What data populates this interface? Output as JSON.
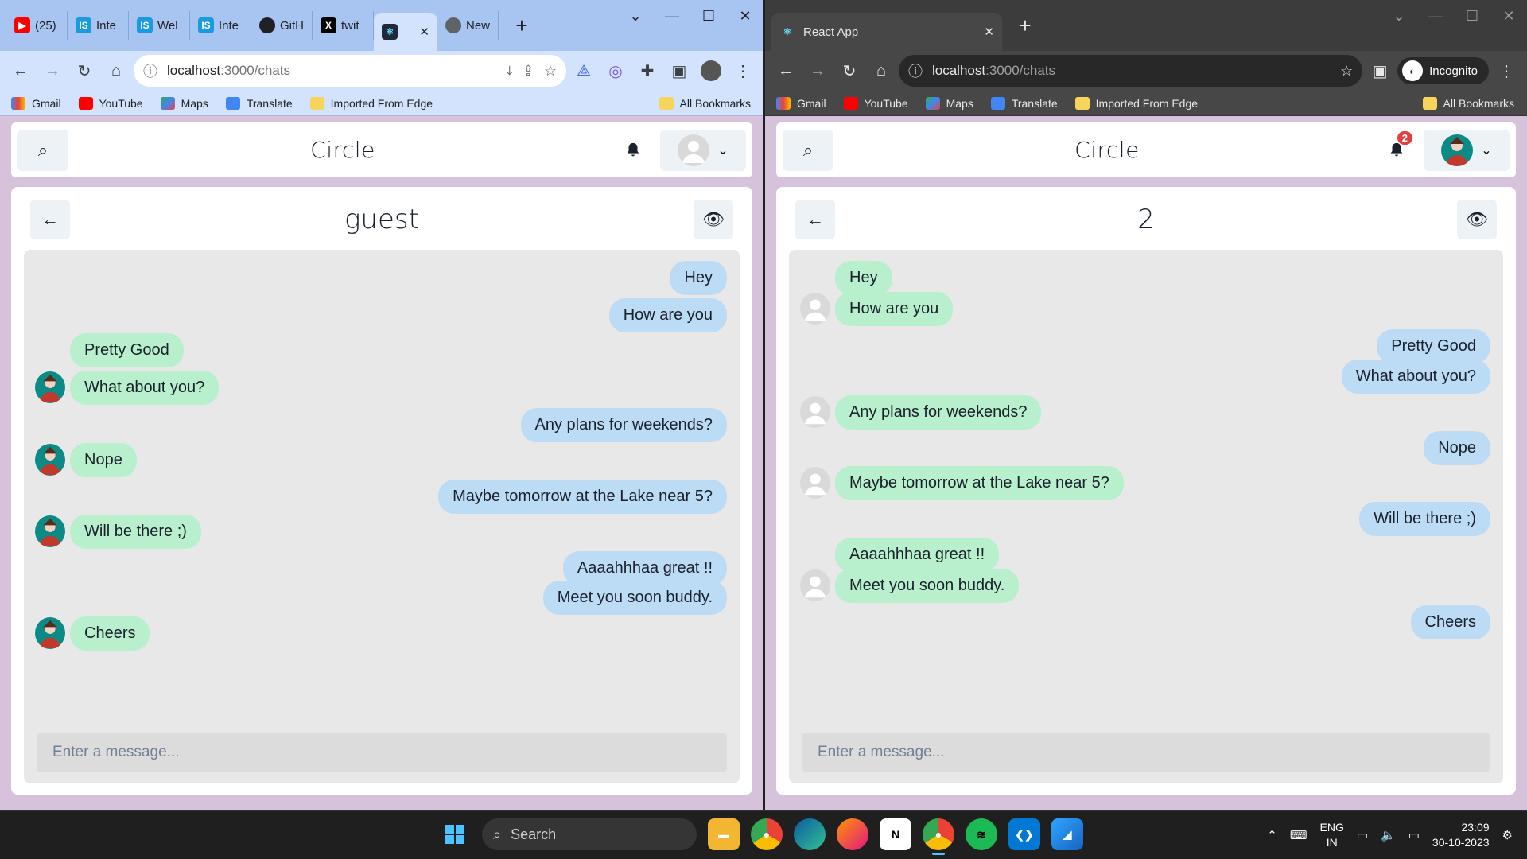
{
  "left_window": {
    "tabs": [
      {
        "label": "(25)",
        "icon": "youtube-icon",
        "color": "#ff0000"
      },
      {
        "label": "Inte",
        "icon": "interviewbit-icon",
        "color": "#1a9be0"
      },
      {
        "label": "Wel",
        "icon": "interviewbit-icon",
        "color": "#1a9be0"
      },
      {
        "label": "Inte",
        "icon": "interviewbit-icon",
        "color": "#1a9be0"
      },
      {
        "label": "GitH",
        "icon": "github-icon",
        "color": "#202124"
      },
      {
        "label": "twit",
        "icon": "x-icon",
        "color": "#000000"
      },
      {
        "label": "",
        "icon": "react-icon",
        "color": "#61dafb"
      },
      {
        "label": "New",
        "icon": "chrome-icon",
        "color": "#5f6368"
      }
    ],
    "url_host": "localhost",
    "url_path": ":3000/chats",
    "bookmarks": [
      "Gmail",
      "YouTube",
      "Maps",
      "Translate",
      "Imported From Edge"
    ],
    "all_bookmarks": "All Bookmarks",
    "app": {
      "brand": "Circle",
      "chat_title": "guest",
      "input_placeholder": "Enter a message..."
    },
    "messages": [
      {
        "text": "Hey",
        "sender": "me"
      },
      {
        "text": "How are you",
        "sender": "me"
      },
      {
        "text": "Pretty Good",
        "sender": "them",
        "avatar": false
      },
      {
        "text": "What about you?",
        "sender": "them",
        "avatar": true
      },
      {
        "text": "Any plans for weekends?",
        "sender": "me"
      },
      {
        "text": "Nope",
        "sender": "them",
        "avatar": true
      },
      {
        "text": "Maybe tomorrow at the Lake near 5?",
        "sender": "me"
      },
      {
        "text": "Will be there ;)",
        "sender": "them",
        "avatar": true
      },
      {
        "text": "Aaaahhhaa great !!",
        "sender": "me"
      },
      {
        "text": "Meet you soon buddy.",
        "sender": "me"
      },
      {
        "text": "Cheers",
        "sender": "them",
        "avatar": true
      }
    ]
  },
  "right_window": {
    "tab_label": "React App",
    "url_host": "localhost",
    "url_path": ":3000/chats",
    "incognito_label": "Incognito",
    "bookmarks": [
      "Gmail",
      "YouTube",
      "Maps",
      "Translate",
      "Imported From Edge"
    ],
    "all_bookmarks": "All Bookmarks",
    "app": {
      "brand": "Circle",
      "notification_count": "2",
      "chat_title": "2",
      "input_placeholder": "Enter a message..."
    },
    "messages": [
      {
        "text": "Hey",
        "sender": "them",
        "avatar": false
      },
      {
        "text": "How are you",
        "sender": "them",
        "avatar": true
      },
      {
        "text": "Pretty Good",
        "sender": "me"
      },
      {
        "text": "What about you?",
        "sender": "me"
      },
      {
        "text": "Any plans for weekends?",
        "sender": "them",
        "avatar": true
      },
      {
        "text": "Nope",
        "sender": "me"
      },
      {
        "text": "Maybe tomorrow at the Lake near 5?",
        "sender": "them",
        "avatar": true
      },
      {
        "text": "Will be there ;)",
        "sender": "me"
      },
      {
        "text": "Aaaahhhaa great !!",
        "sender": "them",
        "avatar": false
      },
      {
        "text": "Meet you soon buddy.",
        "sender": "them",
        "avatar": true
      },
      {
        "text": "Cheers",
        "sender": "me"
      }
    ]
  },
  "taskbar": {
    "search_label": "Search",
    "lang_top": "ENG",
    "lang_bottom": "IN",
    "time": "23:09",
    "date": "30-10-2023"
  },
  "colors": {
    "bubble_me": "#bcdcf5",
    "bubble_them": "#b8f0cd",
    "page_background": "#d6c3db"
  }
}
